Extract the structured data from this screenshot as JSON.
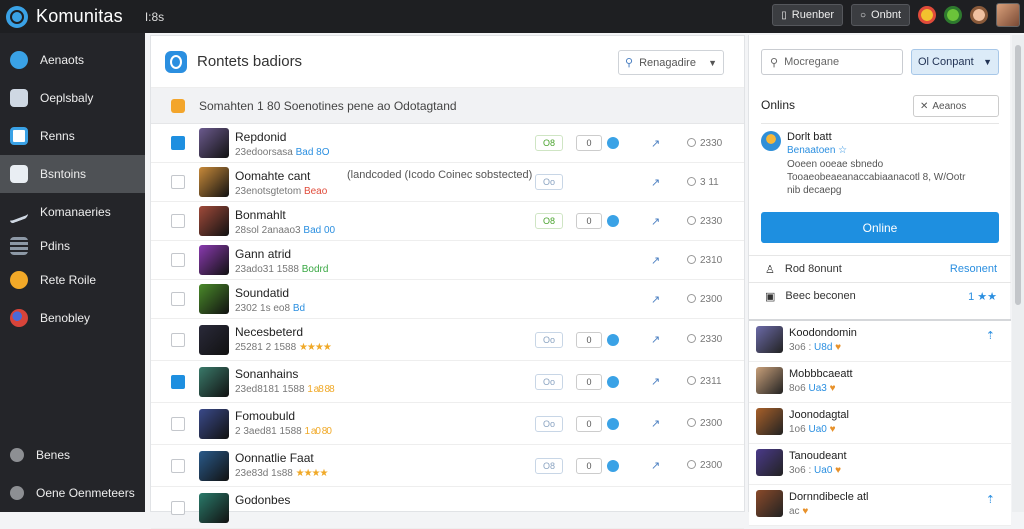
{
  "app": {
    "title": "Komunitas",
    "tab": "I:8s"
  },
  "topbar": {
    "btn1": "Ruenber",
    "btn2": "Onbnt"
  },
  "sidebar": {
    "items": [
      {
        "label": "Aenaots",
        "icon": "globe-icon",
        "color": "#3aa2e6"
      },
      {
        "label": "Oeplsbaly",
        "icon": "book-icon",
        "color": "#cfd8e3"
      },
      {
        "label": "Renns",
        "icon": "document-icon",
        "color": "#3aa2e6"
      },
      {
        "label": "Bsntoins",
        "icon": "tag-icon",
        "color": "#b8c6d3"
      },
      {
        "label": "Komanaeries",
        "icon": "pen-icon",
        "color": "#b8c6d3"
      },
      {
        "label": "Pdins",
        "icon": "grid-icon",
        "color": "#8d99a6"
      },
      {
        "label": "Rete Roile",
        "icon": "sun-icon",
        "color": "#f2a928"
      },
      {
        "label": "Benobley",
        "icon": "ball-icon",
        "color": "#d8443a"
      }
    ],
    "bottom": [
      {
        "label": "Benes",
        "icon": "circle-icon"
      },
      {
        "label": "Oene Oenmeteers",
        "icon": "settings-icon"
      }
    ]
  },
  "main": {
    "title": "Rontets badiors",
    "dropdown": "Renagadire",
    "info": "Somahten  1 80  Soenotines pene ao Odotagtand",
    "rows": [
      {
        "name": "Repdonid",
        "meta": "23edoorsasa",
        "tag": "Bad 8O",
        "tag_class": "",
        "checked": true,
        "note": "",
        "pill": "O8",
        "pill_class": "green",
        "num": "0",
        "time": "2330",
        "thumb": "#6b5a8e"
      },
      {
        "name": "Oomahte cant",
        "meta": "23enotsgtetom",
        "tag": "Beao",
        "tag_class": "red",
        "checked": false,
        "note": "(landcoded (Icodo Coinec sobstected)",
        "pill": "Oo",
        "pill_class": "",
        "num": "",
        "time": "3 11",
        "thumb": "#c88a3a"
      },
      {
        "name": "Bonmahlt",
        "meta": "28sol 2anaao3",
        "tag": "Bad 00",
        "tag_class": "",
        "checked": false,
        "note": "",
        "pill": "O8",
        "pill_class": "green",
        "num": "0",
        "time": "2330",
        "thumb": "#a04a3a"
      },
      {
        "name": "Gann atrid",
        "meta": "23ado31 1588",
        "tag": "Bodrd",
        "tag_class": "green",
        "checked": false,
        "note": "",
        "pill": "",
        "pill_class": "",
        "num": "",
        "time": "2310",
        "thumb": "#8a3ab0"
      },
      {
        "name": "Soundatid",
        "meta": "2302 1s eo8",
        "tag": "Bd",
        "tag_class": "",
        "checked": false,
        "note": "",
        "pill": "",
        "pill_class": "",
        "num": "",
        "time": "2300",
        "thumb": "#4a8a2a"
      },
      {
        "name": "Necesbeterd",
        "meta": "25281 2 1588",
        "tag": "★★★★",
        "tag_class": "stars",
        "checked": false,
        "note": "",
        "pill": "Oo",
        "pill_class": "",
        "num": "0",
        "time": "2330",
        "thumb": "#2a2a3a"
      },
      {
        "name": "Sonanhains",
        "meta": "23ed8181 1588",
        "tag": "1 a8 88",
        "tag_class": "stars",
        "checked": true,
        "note": "",
        "pill": "Oo",
        "pill_class": "",
        "num": "0",
        "time": "2311",
        "thumb": "#3a7a6a"
      },
      {
        "name": "Fomoubuld",
        "meta": "2 3aed81 1588",
        "tag": "1 a0 80",
        "tag_class": "stars",
        "checked": false,
        "note": "",
        "pill": "Oo",
        "pill_class": "",
        "num": "0",
        "time": "2300",
        "thumb": "#3a4a8a"
      },
      {
        "name": "Oonnatlie Faat",
        "meta": "23e83d 1s88",
        "tag": "★★★★",
        "tag_class": "stars",
        "checked": false,
        "note": "",
        "pill": "O8",
        "pill_class": "",
        "num": "0",
        "time": "2300",
        "thumb": "#2a5a8a"
      },
      {
        "name": "Godonbes",
        "meta": "",
        "tag": "",
        "tag_class": "",
        "checked": false,
        "note": "",
        "pill": "",
        "pill_class": "",
        "num": "",
        "time": "",
        "thumb": "#2a7a6a"
      }
    ]
  },
  "right": {
    "search_placeholder": "Mocregane",
    "dropdown": "Ol Conpant",
    "section_title": "Onlins",
    "section_btn": "Aeanos",
    "profile": {
      "name": "Dorlt batt",
      "sub": "Benaatoen ☆",
      "desc": "Ooeen ooeae sbnedo\nTooaeobeaeanaccabiaanacotl 8, W/Ootr\nnib decaepg"
    },
    "online_btn": "Online",
    "row1": {
      "label": "Rod 8onunt",
      "right": "Resonent"
    },
    "row2": {
      "label": "Beec beconen",
      "right": "1 ★★"
    },
    "friends": [
      {
        "name": "Koodondomin",
        "meta": "3o6 :",
        "tag": "U8d",
        "pin": true,
        "thumb": "#6b6aa8"
      },
      {
        "name": "Mobbbcaeatt",
        "meta": "8o6",
        "tag": "Ua3",
        "pin": false,
        "thumb": "#c8a07a"
      },
      {
        "name": "Joonodagtal",
        "meta": "1o6",
        "tag": "Ua0",
        "pin": false,
        "thumb": "#a8602a"
      },
      {
        "name": "Tanoudeant",
        "meta": "3o6 :",
        "tag": "Ua0",
        "pin": false,
        "thumb": "#4a3a8a"
      },
      {
        "name": "Dornndibecle atl",
        "meta": "ac",
        "tag": "",
        "pin": true,
        "thumb": "#8a4a2a"
      }
    ]
  }
}
